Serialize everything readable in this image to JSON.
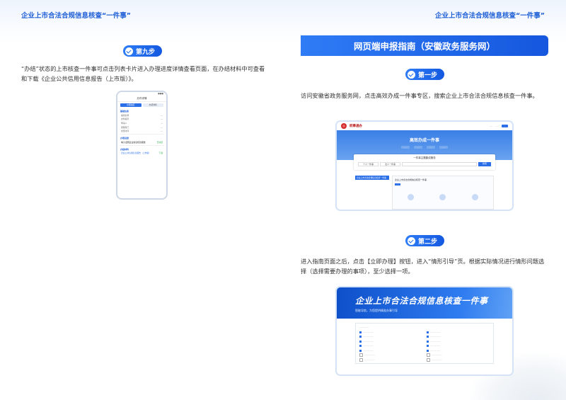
{
  "left_page": {
    "running_head": "企业上市合法合规信息核查“一件事”",
    "step": "第九步",
    "text": "“办结”状态的上市核查一件事可点击列表卡片进入办理进度详情查看页面，在办结材料中可查看和下载《企业公共信用信息报告（上市版）》。"
  },
  "right_page": {
    "running_head": "企业上市合法合规信息核查“一件事”",
    "section_title": "网页端申报指南（安徽政务服务网）",
    "step1": "第一步",
    "step1_text": "访问安徽省政务服务网，点击高效办成一件事专区，搜索企业上市合法合规信息核查一件事。",
    "step2": "第二步",
    "step2_text": "进入指南页面之后，点击【立即办理】按钮，进入“情形引导”页。根据实际情况进行情形问题选择（选择需要办理的事项），至少选择一项。"
  },
  "phone": {
    "title": "办件详情",
    "tab_active": "办理进度",
    "tab_other": "办结材料",
    "section1": "基础信息",
    "rows": [
      [
        "事项名称",
        "—"
      ],
      [
        "办件编号",
        "—"
      ],
      [
        "申请人",
        "—"
      ],
      [
        "受理部门",
        "—"
      ],
      [
        "办结时间",
        "—"
      ]
    ],
    "section2": "办理进度",
    "progress_item": "电子证照企业信息核查报告",
    "progress_status": "已办结",
    "section3": "办结材料",
    "material": "企业公共信用信息报告（上市版）",
    "download": "下载"
  },
  "shot1": {
    "brand": "皖事通办",
    "banner_title": "高效办成一件事",
    "search_title": "一件事主题集成服务",
    "tab1": "个人一件事",
    "tab2": "法人一件事",
    "search_btn": "搜索",
    "side_item": "企业上市合法合规信息核查一件事",
    "main_title": "企业上市合法合规信息核查一件事"
  },
  "shot2": {
    "banner_title": "企业上市合法合规信息核查一件事",
    "banner_sub": "智能导航，为您提供精准办事引导"
  }
}
